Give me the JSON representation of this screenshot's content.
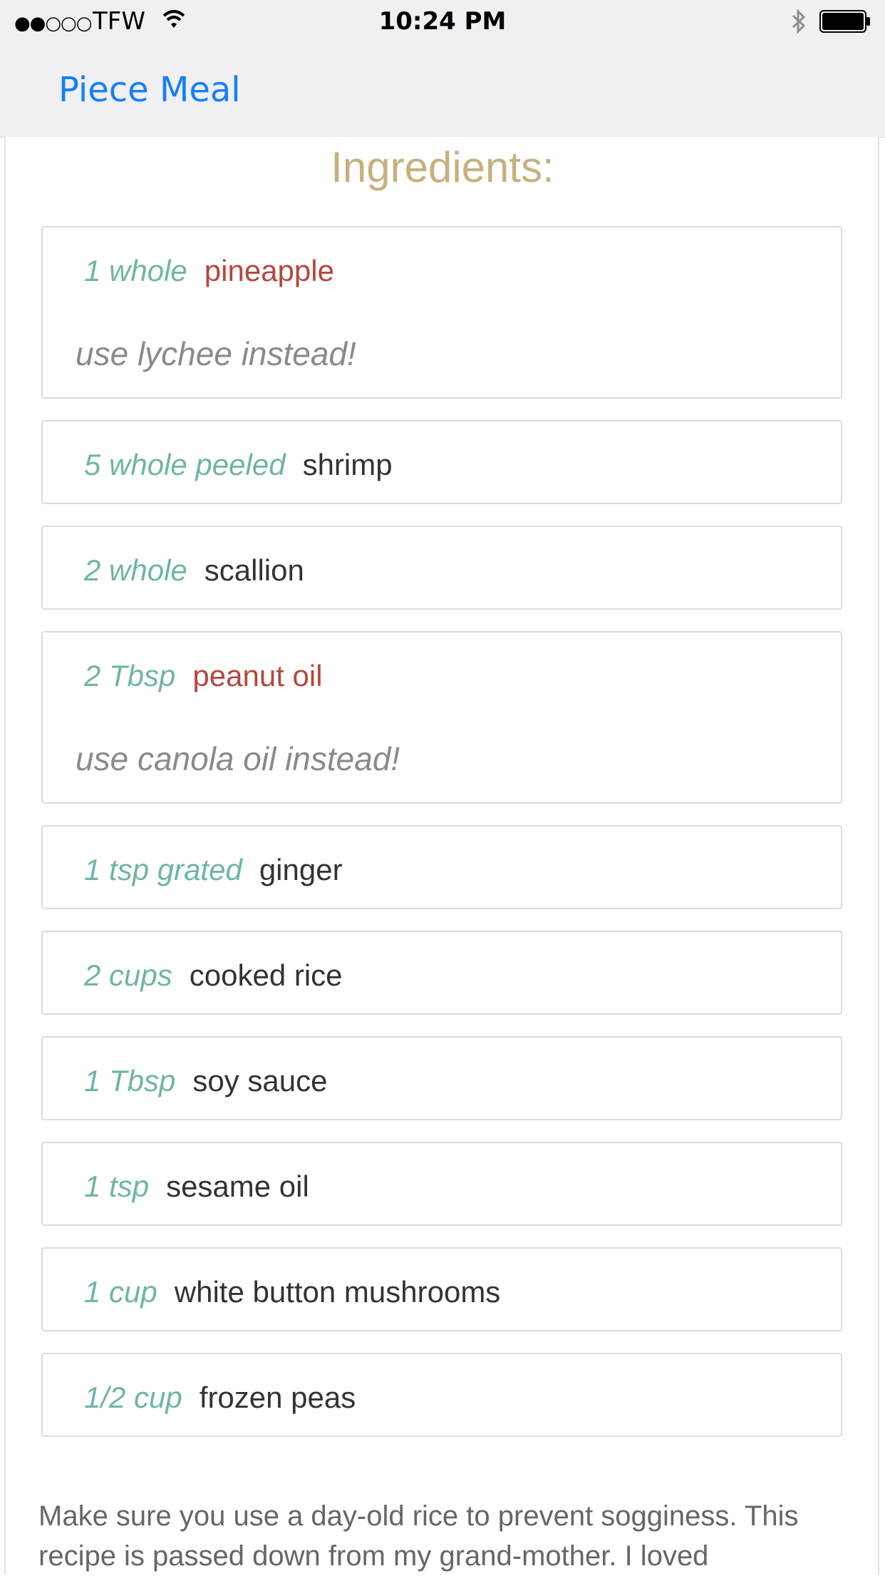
{
  "status_bar": {
    "signal": "●●○○○",
    "carrier": "TFW",
    "time": "10:24 PM"
  },
  "nav": {
    "title": "Piece Meal"
  },
  "ingredients_heading": "Ingredients:",
  "ingredients": [
    {
      "qty": "1 whole",
      "name": "pineapple",
      "highlight": true,
      "note": "use lychee instead!"
    },
    {
      "qty": "5 whole peeled",
      "name": "shrimp"
    },
    {
      "qty": "2 whole",
      "name": "scallion"
    },
    {
      "qty": "2 Tbsp",
      "name": "peanut oil",
      "highlight": true,
      "note": "use canola oil instead!"
    },
    {
      "qty": "1 tsp grated",
      "name": "ginger"
    },
    {
      "qty": "2 cups",
      "name": "cooked rice"
    },
    {
      "qty": "1 Tbsp",
      "name": "soy sauce"
    },
    {
      "qty": "1 tsp",
      "name": "sesame oil"
    },
    {
      "qty": "1 cup",
      "name": "white button mushrooms"
    },
    {
      "qty": "1/2 cup",
      "name": "frozen peas"
    }
  ],
  "footer_text": "Make sure you use a day-old rice to prevent sogginess. This recipe is passed down from my grand-mother. I loved"
}
